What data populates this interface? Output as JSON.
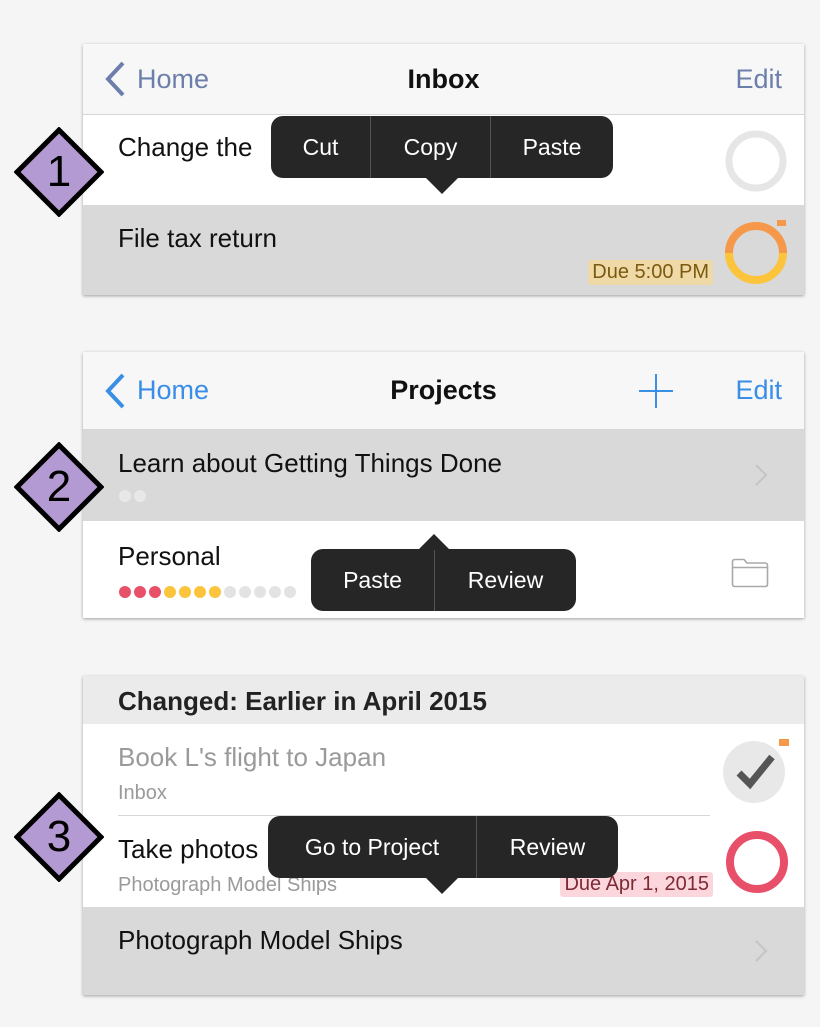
{
  "colors": {
    "nav_slate": "#6c7fab",
    "nav_blue": "#3a8ee6",
    "annotation_fill": "#b49ad2",
    "popover_bg": "#262626",
    "due_soon_bg": "#efd9a6",
    "overdue_bg": "#fbd6dc",
    "overdue_ring": "#e8506a",
    "flag_orange": "#f5984a",
    "dot_red": "#e8506a",
    "dot_yellow": "#fbc43c",
    "dot_gray": "#e3e3e3"
  },
  "panel1": {
    "annotation": "1",
    "nav": {
      "back_label": "Home",
      "title": "Inbox",
      "edit_label": "Edit"
    },
    "rows": [
      {
        "title": "Change the",
        "status_icon": "empty-circle-icon"
      },
      {
        "title": "File tax return",
        "badge": "Due 5:00 PM",
        "status_icon": "due-soon-circle-icon",
        "flagged": true
      }
    ],
    "popover": {
      "items": [
        "Cut",
        "Copy",
        "Paste"
      ]
    }
  },
  "panel2": {
    "annotation": "2",
    "nav": {
      "back_label": "Home",
      "title": "Projects",
      "add_icon": "plus-icon",
      "edit_label": "Edit"
    },
    "rows": [
      {
        "title": "Learn about Getting Things Done",
        "dots": [
          "gray",
          "gray"
        ],
        "accessory": "chevron-right-icon"
      },
      {
        "title": "Personal",
        "dots": [
          "red",
          "red",
          "red",
          "yellow",
          "yellow",
          "yellow",
          "yellow",
          "gray",
          "gray",
          "gray",
          "gray",
          "gray"
        ],
        "accessory": "folder-icon"
      }
    ],
    "popover": {
      "items": [
        "Paste",
        "Review"
      ]
    }
  },
  "panel3": {
    "annotation": "3",
    "section_header": "Changed: Earlier in April 2015",
    "rows": [
      {
        "title": "Book L's flight to Japan",
        "subtitle": "Inbox",
        "status_icon": "completed-check-icon",
        "flagged": true
      },
      {
        "title": "Take photos",
        "subtitle": "Photograph Model Ships",
        "badge": "Due Apr 1, 2015",
        "status_icon": "overdue-circle-icon"
      },
      {
        "title": "Photograph Model Ships",
        "accessory": "chevron-right-icon"
      }
    ],
    "popover": {
      "items": [
        "Go to Project",
        "Review"
      ]
    }
  }
}
